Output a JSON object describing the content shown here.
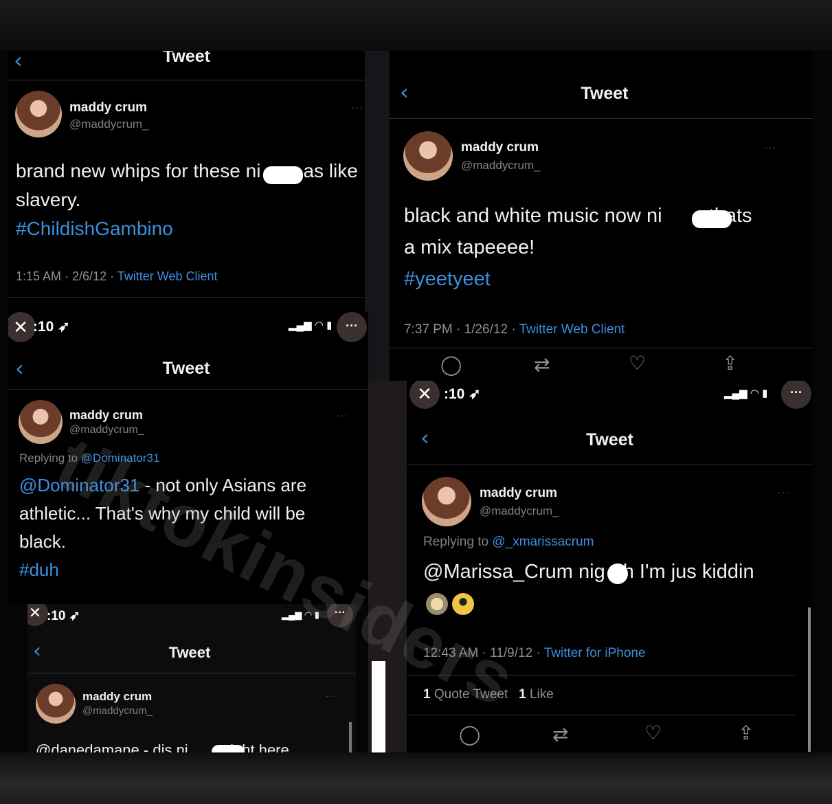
{
  "common": {
    "tweet_title": "Tweet",
    "user_name": "maddy crum",
    "user_handle": "@maddycrum_",
    "more": "···",
    "time": ":10",
    "close_icon": "close-icon",
    "more_icon": "more-icon"
  },
  "tweet1": {
    "text_a": "brand new whips for these ni",
    "text_b": "as like",
    "text_c": "slavery.",
    "hashtag": "#ChildishGambino",
    "meta": "1:15 AM · 2/6/12 · ",
    "source": "Twitter Web Client"
  },
  "tweet2": {
    "text_a": "black and white music now ni",
    "text_b": " thats",
    "text_c": "a mix tapeeee!",
    "hashtag": "#yeetyeet",
    "meta": "7:37 PM · 1/26/12 · ",
    "source": "Twitter Web Client"
  },
  "tweet3": {
    "replying_prefix": "Replying to ",
    "replying_to": "@Dominator31",
    "mention": "@Dominator31",
    "text_a": " - not only Asians are",
    "text_b": "athletic... That's why my child will be",
    "text_c": "black.",
    "hashtag": "#duh"
  },
  "tweet4": {
    "replying_prefix": "Replying to ",
    "replying_to": "@_xmarissacrum",
    "text_a": "@Marissa_Crum nig",
    "text_b": "h I'm jus kiddin",
    "meta": "12:43 AM · 11/9/12 · ",
    "source": "Twitter for iPhone",
    "quote_count": "1",
    "quote_label": " Quote Tweet",
    "like_count": "1",
    "like_label": " Like"
  },
  "tweet5": {
    "text_a": "@danedamane - dis ni",
    "text_b": " right here"
  },
  "watermark": "tiktokinsiders",
  "colors": {
    "accent": "#3d8fe0",
    "background": "#000000",
    "muted": "#8b9298"
  }
}
